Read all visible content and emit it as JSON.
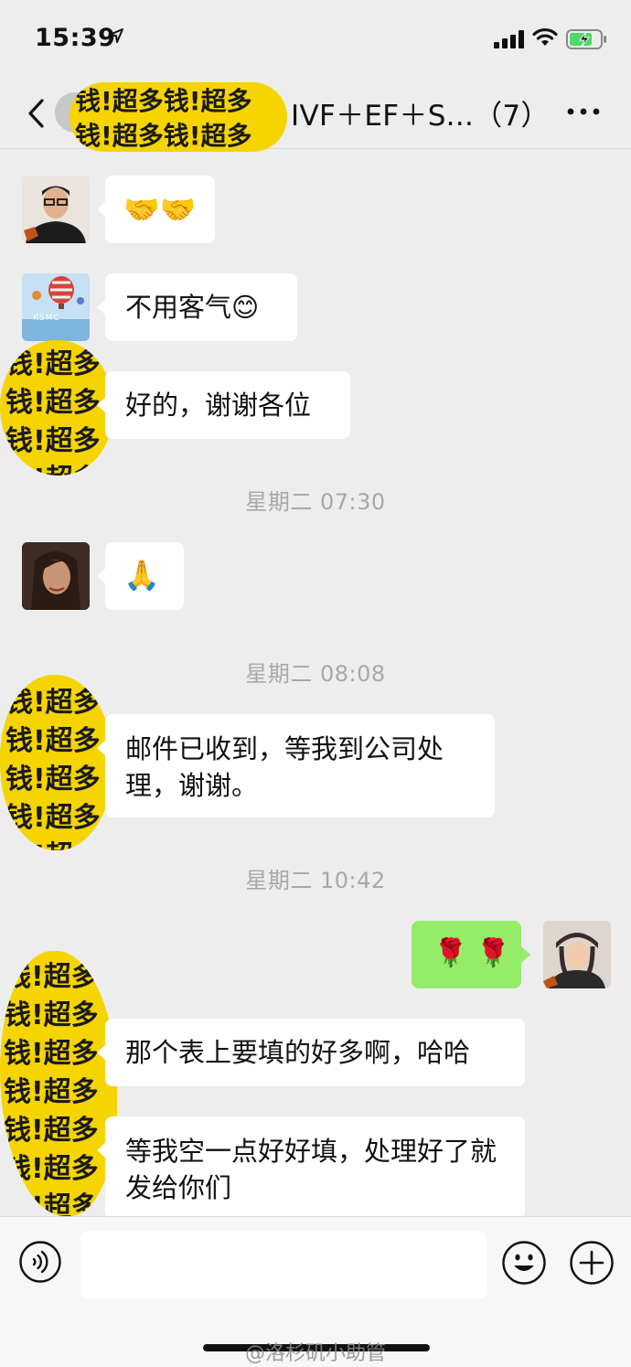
{
  "status": {
    "time": "15:39"
  },
  "nav": {
    "title": "IVF＋EF＋S...（7）"
  },
  "censor": {
    "text": "钱!超多钱!超多钱!超多钱!超多钱!超多钱!超多钱!超多钱!超多"
  },
  "messages": [
    {
      "side": "left",
      "text": "🤝🤝"
    },
    {
      "side": "left",
      "text": "不用客气😊"
    },
    {
      "side": "left",
      "text": "好的，谢谢各位"
    },
    {
      "type": "time",
      "text": "星期二 07:30"
    },
    {
      "side": "left",
      "text": "🙏"
    },
    {
      "type": "time",
      "text": "星期二 08:08"
    },
    {
      "side": "left",
      "text": "邮件已收到，等我到公司处理，谢谢。"
    },
    {
      "type": "time",
      "text": "星期二 10:42"
    },
    {
      "side": "right",
      "text": "🌹 🌹"
    },
    {
      "side": "left",
      "text": "那个表上要填的好多啊，哈哈"
    },
    {
      "side": "left",
      "text": "等我空一点好好填，处理好了就发给你们"
    }
  ],
  "avatar_labels": {
    "ksmc": "KSMC"
  },
  "watermark": "@洛杉矶小助管",
  "colors": {
    "background": "#ededed",
    "self_bubble": "#95ec69",
    "other_bubble": "#ffffff",
    "censor": "#f5d400"
  }
}
